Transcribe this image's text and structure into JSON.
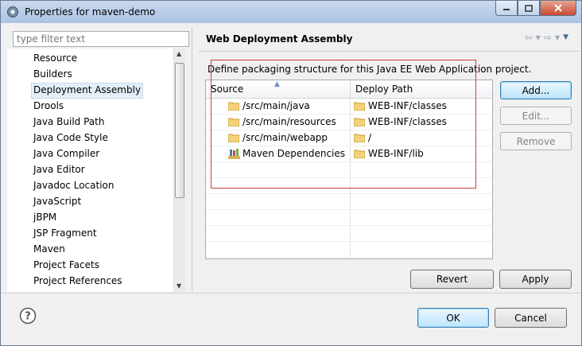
{
  "window": {
    "title": "Properties for maven-demo",
    "icon": "properties-gear-icon"
  },
  "filter": {
    "placeholder": "type filter text",
    "value": ""
  },
  "tree": {
    "items": [
      {
        "label": "Resource"
      },
      {
        "label": "Builders"
      },
      {
        "label": "Deployment Assembly",
        "selected": true
      },
      {
        "label": "Drools"
      },
      {
        "label": "Java Build Path"
      },
      {
        "label": "Java Code Style"
      },
      {
        "label": "Java Compiler"
      },
      {
        "label": "Java Editor"
      },
      {
        "label": "Javadoc Location"
      },
      {
        "label": "JavaScript"
      },
      {
        "label": "jBPM"
      },
      {
        "label": "JSP Fragment"
      },
      {
        "label": "Maven"
      },
      {
        "label": "Project Facets"
      },
      {
        "label": "Project References"
      }
    ]
  },
  "page": {
    "title": "Web Deployment Assembly",
    "description": "Define packaging structure for this Java EE Web Application project."
  },
  "table": {
    "headers": {
      "source": "Source",
      "deploy": "Deploy Path"
    },
    "rows": [
      {
        "source": "/src/main/java",
        "deploy": "WEB-INF/classes",
        "source_icon": "folder-icon"
      },
      {
        "source": "/src/main/resources",
        "deploy": "WEB-INF/classes",
        "source_icon": "folder-icon"
      },
      {
        "source": "/src/main/webapp",
        "deploy": "/",
        "source_icon": "folder-icon"
      },
      {
        "source": "Maven Dependencies",
        "deploy": "WEB-INF/lib",
        "source_icon": "library-icon"
      }
    ]
  },
  "buttons": {
    "add": "Add...",
    "edit": "Edit...",
    "remove": "Remove",
    "revert": "Revert",
    "apply": "Apply",
    "ok": "OK",
    "cancel": "Cancel"
  },
  "colors": {
    "highlight_box": "#d23a3a",
    "selection": "#e5eef8",
    "folder": "#e8c35a"
  }
}
